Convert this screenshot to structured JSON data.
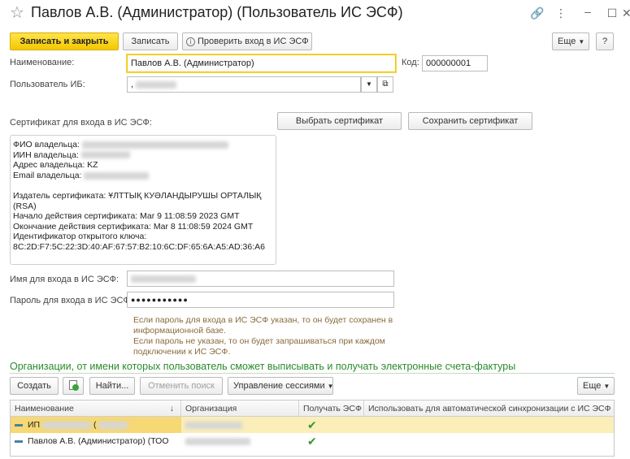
{
  "window": {
    "title": "Павлов А.В. (Администратор) (Пользователь ИС ЭСФ)"
  },
  "toolbar": {
    "save_close": "Записать и закрыть",
    "save": "Записать",
    "check_login": "Проверить вход в ИС ЭСФ",
    "more": "Еще",
    "help": "?"
  },
  "form": {
    "name_label": "Наименование:",
    "name_value": "Павлов А.В. (Администратор)",
    "code_label": "Код:",
    "code_value": "000000001",
    "ib_user_label": "Пользователь ИБ:",
    "ib_user_value": ","
  },
  "certificate": {
    "label": "Сертификат для входа в ИС ЭСФ:",
    "select_button": "Выбрать сертификат",
    "save_button": "Сохранить сертификат",
    "fio_label": "ФИО владельца:",
    "iin_label": "ИИН владельца:",
    "address": "Адрес владельца: KZ",
    "email_label": "Email владельца:",
    "issuer": "Издатель сертификата: ҰЛТТЫҚ КУӘЛАНДЫРУШЫ ОРТАЛЫҚ",
    "issuer_cont": "(RSA)",
    "valid_from": "Начало действия сертификата: Mar  9 11:08:59 2023 GMT",
    "valid_to": "Окончание действия сертификата: Mar  8 11:08:59 2024 GMT",
    "key_id_label": "Идентификатор открытого ключа:",
    "key_id": "8C:2D:F7:5C:22:3D:40:AF:67:57:B2:10:6C:DF:65:6A:A5:AD:36:A6"
  },
  "login": {
    "login_label": "Имя для входа в ИС ЭСФ:",
    "password_label": "Пароль для входа в ИС ЭСФ:",
    "password_value": "●●●●●●●●●●●",
    "hint_lines": [
      "Если пароль для входа в ИС ЭСФ указан, то он будет сохранен в",
      "информационной базе.",
      "Если пароль не указан, то он будет запрашиваться при каждом",
      "подключении к ИС ЭСФ."
    ]
  },
  "orgs": {
    "title": "Организации, от имени которых пользователь сможет выписывать и получать электронные счета-фактуры",
    "create": "Создать",
    "find": "Найти...",
    "cancel_search": "Отменить поиск",
    "sessions": "Управление сессиями",
    "more": "Еще",
    "columns": [
      "Наименование",
      "Организация",
      "Получать ЭСФ",
      "Использовать для автоматической синхронизации с ИС ЭСФ"
    ],
    "sort_indicator": "↓",
    "rows": [
      {
        "name": "ИП",
        "name_tail": "(",
        "org": "",
        "receive": "✔",
        "auto": ""
      },
      {
        "name": "Павлов А.В. (Администратор) (ТОО",
        "name_tail": "",
        "org": "",
        "receive": "✔",
        "auto": ""
      }
    ]
  },
  "colors": {
    "accent": "#f4c800",
    "section_title": "#2b8a2b",
    "selected_row": "#fbeeb8",
    "check": "#2e9b2e"
  }
}
